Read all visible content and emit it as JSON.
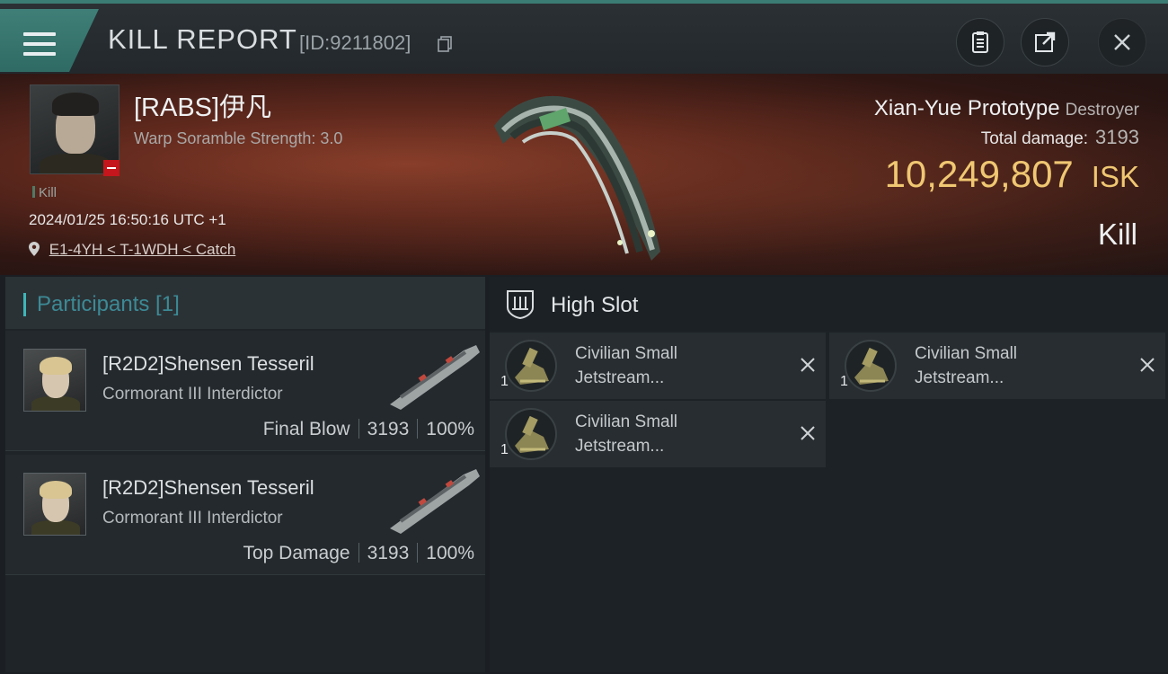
{
  "header": {
    "title": "KILL REPORT",
    "report_id": "[ID:9211802]",
    "icons": [
      "menu-icon",
      "copy-icon",
      "clipboard-icon",
      "share-icon",
      "close-icon"
    ]
  },
  "victim": {
    "name": "[RABS]伊凡",
    "warp_scramble": "Warp Soramble Strength: 3.0",
    "kill_tag": "Kill",
    "datetime": "2024/01/25 16:50:16 UTC +1",
    "location": "E1-4YH < T-1WDH < Catch",
    "ship_name": "Xian-Yue Prototype",
    "ship_class": "Destroyer",
    "total_damage_label": "Total damage:",
    "total_damage": "3193",
    "isk_value": "10,249,807",
    "isk_unit": "ISK",
    "result": "Kill"
  },
  "participants": {
    "header": "Participants [1]",
    "rows": [
      {
        "name": "[R2D2]Shensen Tesseril",
        "ship": "Cormorant III Interdictor",
        "role": "Final Blow",
        "damage": "3193",
        "percent": "100%"
      },
      {
        "name": "[R2D2]Shensen Tesseril",
        "ship": "Cormorant III Interdictor",
        "role": "Top Damage",
        "damage": "3193",
        "percent": "100%"
      }
    ]
  },
  "slots": {
    "header": "High Slot",
    "items": [
      {
        "qty": "1",
        "line1": "Civilian Small",
        "line2": "Jetstream..."
      },
      {
        "qty": "1",
        "line1": "Civilian Small",
        "line2": "Jetstream..."
      },
      {
        "qty": "1",
        "line1": "Civilian Small",
        "line2": "Jetstream..."
      }
    ]
  },
  "colors": {
    "accent_teal": "#3fb5b8",
    "isk_gold": "#f0c772",
    "banner_red": "#5c271c",
    "status_red": "#c4161c"
  }
}
